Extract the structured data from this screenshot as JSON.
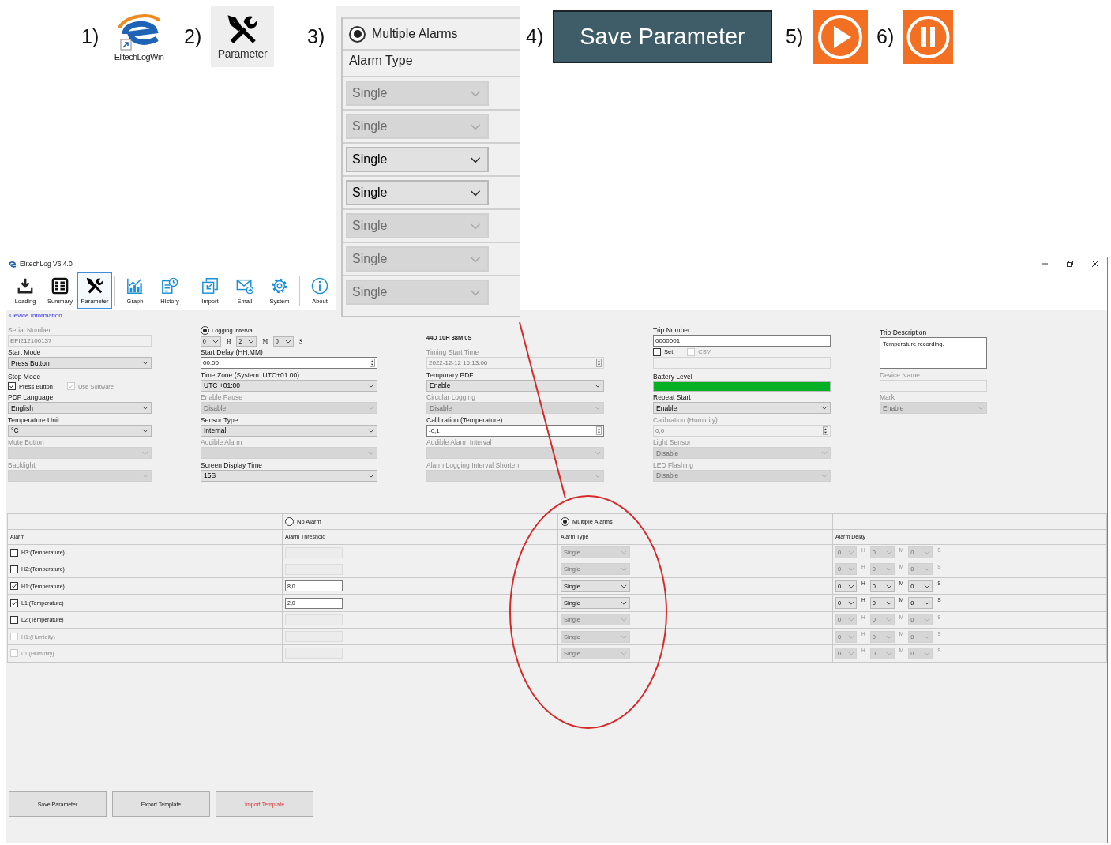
{
  "callouts": [
    {
      "number": "1)",
      "kind": "app_icon",
      "caption": "ElitechLogWin"
    },
    {
      "number": "2)",
      "kind": "tool_icon",
      "caption": "Parameter"
    },
    {
      "number": "3)",
      "kind": "panel",
      "radio": {
        "label": "Multiple Alarms",
        "selected": true
      },
      "header": "Alarm Type",
      "selects": [
        {
          "value": "Single",
          "disabled": true
        },
        {
          "value": "Single",
          "disabled": true
        },
        {
          "value": "Single",
          "disabled": false
        },
        {
          "value": "Single",
          "disabled": false
        },
        {
          "value": "Single",
          "disabled": true
        },
        {
          "value": "Single",
          "disabled": true
        },
        {
          "value": "Single",
          "disabled": true
        }
      ]
    },
    {
      "number": "4)",
      "kind": "button",
      "label": "Save Parameter"
    },
    {
      "number": "5)",
      "kind": "play"
    },
    {
      "number": "6)",
      "kind": "pause"
    }
  ],
  "window": {
    "title": "ElitechLog V6.4.0",
    "toolbar": [
      {
        "label": "Loading",
        "selected": false,
        "separator_after": false
      },
      {
        "label": "Summary",
        "selected": false,
        "separator_after": false
      },
      {
        "label": "Parameter",
        "selected": true,
        "separator_after": true
      },
      {
        "label": "Graph",
        "selected": false,
        "separator_after": false
      },
      {
        "label": "History",
        "selected": false,
        "separator_after": true
      },
      {
        "label": "Import",
        "selected": false,
        "separator_after": false
      },
      {
        "label": "Email",
        "selected": false,
        "separator_after": false
      },
      {
        "label": "System",
        "selected": false,
        "separator_after": true
      },
      {
        "label": "About",
        "selected": false,
        "separator_after": false
      }
    ],
    "section_tab": "Device Information",
    "form": {
      "columns": [
        [
          {
            "kind": "text",
            "label": "Serial Number",
            "value": "EFI212100137",
            "disabled": true
          },
          {
            "kind": "select",
            "label": "Start Mode",
            "value": "Press Button",
            "disabled": false
          },
          {
            "kind": "checks",
            "label": "Stop Mode",
            "options": [
              {
                "label": "Press Button",
                "checked": true,
                "disabled": false
              },
              {
                "label": "Use Software",
                "checked": true,
                "disabled": true
              }
            ]
          },
          {
            "kind": "select",
            "label": "PDF Language",
            "value": "English",
            "disabled": false
          },
          {
            "kind": "select",
            "label": "Temperature Unit",
            "value": "°C",
            "disabled": false
          },
          {
            "kind": "select",
            "label": "Mute Button",
            "disabled": true
          },
          {
            "kind": "select",
            "label": "Backlight",
            "disabled": true
          }
        ],
        [
          {
            "kind": "interval",
            "label": "Logging Interval",
            "selected": true,
            "parts": [
              {
                "value": "0",
                "unit": "H"
              },
              {
                "value": "2",
                "unit": "M"
              },
              {
                "value": "0",
                "unit": "S"
              }
            ]
          },
          {
            "kind": "spin",
            "label": "Start Delay (HH:MM)",
            "value": "00:00",
            "disabled": false
          },
          {
            "kind": "select",
            "label": "Time Zone (System: UTC+01:00)",
            "value": "UTC +01:00",
            "disabled": false
          },
          {
            "kind": "select",
            "label": "Enable Pause",
            "value": "Disable",
            "disabled": true
          },
          {
            "kind": "select",
            "label": "Sensor Type",
            "value": "Internal",
            "disabled": false
          },
          {
            "kind": "select",
            "label": "Audible Alarm",
            "disabled": true
          },
          {
            "kind": "select",
            "label": "Screen Display Time",
            "value": "15S",
            "disabled": false
          }
        ],
        [
          {
            "kind": "note",
            "value": "44D 10H 38M 0S"
          },
          {
            "kind": "spin",
            "label": "Timing Start Time",
            "value": "2022-12-12 16:13:06",
            "disabled": true
          },
          {
            "kind": "select",
            "label": "Temporary PDF",
            "value": "Enable",
            "disabled": false
          },
          {
            "kind": "select",
            "label": "Circular Logging",
            "value": "Disable",
            "disabled": true
          },
          {
            "kind": "spin",
            "label": "Calibration (Temperature)",
            "value": "-0,1",
            "disabled": false
          },
          {
            "kind": "select",
            "label": "Audible Alarm Interval",
            "disabled": true
          },
          {
            "kind": "select",
            "label": "Alarm Logging Interval Shorten",
            "disabled": true
          }
        ],
        [
          {
            "kind": "text",
            "label": "Trip Number",
            "value": "0000001",
            "disabled": false
          },
          {
            "kind": "checks",
            "options": [
              {
                "label": "Set",
                "checked": false,
                "disabled": false
              },
              {
                "label": "CSV",
                "checked": false,
                "disabled": true
              }
            ],
            "input_disabled": true
          },
          {
            "kind": "meter",
            "label": "Battery Level",
            "level": 1
          },
          {
            "kind": "select",
            "label": "Repeat Start",
            "value": "Enable",
            "disabled": false
          },
          {
            "kind": "spin",
            "label": "Calibration (Humidity)",
            "value": "0,0",
            "disabled": true
          },
          {
            "kind": "select",
            "label": "Light Sensor",
            "value": "Disable",
            "disabled": true
          },
          {
            "kind": "select",
            "label": "LED Flashing",
            "value": "Disable",
            "disabled": true
          }
        ],
        [
          {
            "kind": "textarea",
            "label": "Trip Description",
            "value": "Temperature recording."
          },
          {
            "kind": "text",
            "label": "Device Name",
            "disabled": true
          },
          {
            "kind": "select",
            "label": "Mark",
            "value": "Enable",
            "disabled": true
          }
        ]
      ]
    },
    "alarms": {
      "modes": [
        {
          "label": "No Alarm",
          "selected": false
        },
        {
          "label": "Multiple Alarms",
          "selected": true
        }
      ],
      "columns": [
        "Alarm",
        "Alarm Threshold",
        "Alarm Type",
        "Alarm Delay"
      ],
      "rows": [
        {
          "label": "H3:(Temperature)",
          "checked": false,
          "disabled": false,
          "type": "Single",
          "delay": [
            {
              "value": "0",
              "unit": "H"
            },
            {
              "value": "0",
              "unit": "M"
            },
            {
              "value": "0",
              "unit": "S"
            }
          ]
        },
        {
          "label": "H2:(Temperature)",
          "checked": false,
          "disabled": false,
          "type": "Single",
          "delay": [
            {
              "value": "0",
              "unit": "H"
            },
            {
              "value": "0",
              "unit": "M"
            },
            {
              "value": "0",
              "unit": "S"
            }
          ]
        },
        {
          "label": "H1:(Temperature)",
          "checked": true,
          "disabled": false,
          "threshold": "8,0",
          "type": "Single",
          "delay": [
            {
              "value": "0",
              "unit": "H"
            },
            {
              "value": "0",
              "unit": "M"
            },
            {
              "value": "0",
              "unit": "S"
            }
          ]
        },
        {
          "label": "L1:(Temperature)",
          "checked": true,
          "disabled": false,
          "threshold": "2,0",
          "type": "Single",
          "delay": [
            {
              "value": "0",
              "unit": "H"
            },
            {
              "value": "0",
              "unit": "M"
            },
            {
              "value": "0",
              "unit": "S"
            }
          ]
        },
        {
          "label": "L2:(Temperature)",
          "checked": false,
          "disabled": false,
          "type": "Single",
          "delay": [
            {
              "value": "0",
              "unit": "H"
            },
            {
              "value": "0",
              "unit": "M"
            },
            {
              "value": "0",
              "unit": "S"
            }
          ]
        },
        {
          "label": "H1:(Humidity)",
          "checked": false,
          "disabled": true,
          "type": "Single",
          "delay": [
            {
              "value": "0",
              "unit": "H"
            },
            {
              "value": "0",
              "unit": "M"
            },
            {
              "value": "0",
              "unit": "S"
            }
          ]
        },
        {
          "label": "L1:(Humidity)",
          "checked": false,
          "disabled": true,
          "type": "Single",
          "delay": [
            {
              "value": "0",
              "unit": "H"
            },
            {
              "value": "0",
              "unit": "M"
            },
            {
              "value": "0",
              "unit": "S"
            }
          ]
        }
      ]
    },
    "buttons": [
      {
        "label": "Save Parameter",
        "kind": "save"
      },
      {
        "label": "Export Template",
        "kind": "export"
      },
      {
        "label": "Import Template",
        "kind": "import"
      }
    ]
  }
}
